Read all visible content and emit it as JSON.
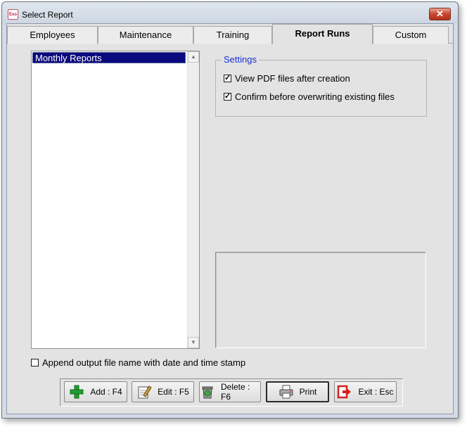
{
  "window": {
    "title": "Select Report",
    "app_icon_text": "Exo",
    "close_glyph": "✕"
  },
  "tabs": [
    {
      "label": "Employees",
      "active": false
    },
    {
      "label": "Maintenance",
      "active": false
    },
    {
      "label": "Training",
      "active": false
    },
    {
      "label": "Report Runs",
      "active": true
    },
    {
      "label": "Custom",
      "active": false
    }
  ],
  "report_list": {
    "items": [
      "Monthly Reports"
    ],
    "selected": "Monthly Reports"
  },
  "settings": {
    "legend": "Settings",
    "view_pdf": {
      "label": "View PDF files after creation",
      "checked": true
    },
    "confirm_overwrite": {
      "label": "Confirm before overwriting existing files",
      "checked": true
    }
  },
  "append_timestamp": {
    "label": "Append output file name with date and time stamp",
    "checked": false
  },
  "buttons": {
    "add": {
      "label": "Add : F4",
      "icon": "add-plus-icon"
    },
    "edit": {
      "label": "Edit : F5",
      "icon": "edit-pencil-icon"
    },
    "delete": {
      "label": "Delete : F6",
      "icon": "delete-bin-icon"
    },
    "print": {
      "label": "Print",
      "icon": "printer-icon"
    },
    "exit": {
      "label": "Exit : Esc",
      "icon": "exit-door-icon"
    }
  },
  "colors": {
    "selection": "#0a0a7e",
    "legend": "#1a2fd4",
    "add_icon": "#1f9e2f",
    "exit_icon": "#d42020"
  }
}
